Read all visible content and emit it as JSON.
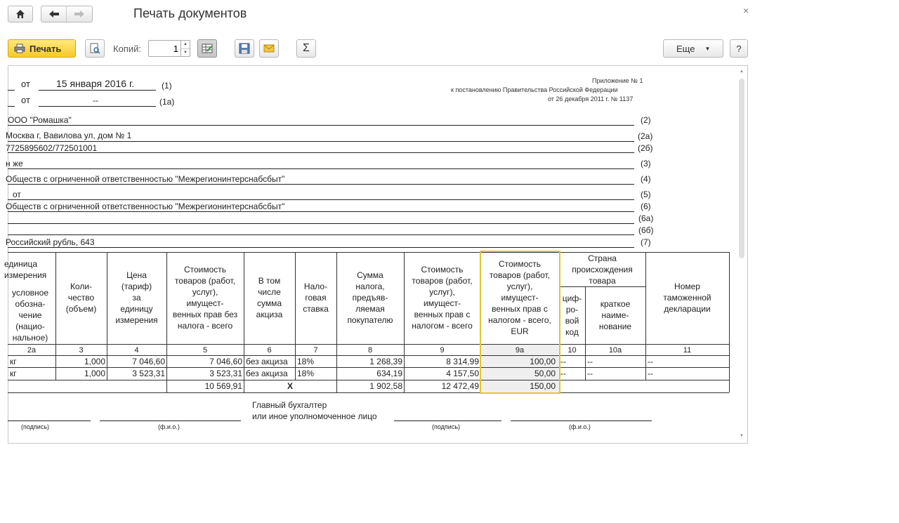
{
  "window": {
    "title": "Печать документов",
    "close_glyph": "×"
  },
  "toolbar": {
    "print_label": "Печать",
    "copies_label": "Копий:",
    "copies_value": "1",
    "more_label": "Еще",
    "help_label": "?",
    "sum_glyph": "Σ"
  },
  "document": {
    "appendix": {
      "line1": "Приложение № 1",
      "line2": "к постановлению Правительства Российской Федерации",
      "line3": "от 26 декабря 2011 г. № 1137"
    },
    "header_rows": [
      {
        "prefix": "от",
        "value": "15 января 2016 г.",
        "code": "(1)"
      },
      {
        "prefix": "от",
        "value": "--",
        "code": "(1а)"
      }
    ],
    "fields": [
      {
        "value": "ООО \"Ромашка\"",
        "code": "(2)"
      },
      {
        "value": "Москва г, Вавилова ул, дом № 1",
        "code": "(2а)"
      },
      {
        "value": "7725895602/772501001",
        "code": "(2б)"
      },
      {
        "value": "н же",
        "code": "(3)"
      },
      {
        "value": "Обществ с огрниченной ответственностью \"Межрегионинтерснабсбыт\"",
        "code": "(4)"
      },
      {
        "value": "от",
        "code": "(5)"
      },
      {
        "value": "Обществ с огрниченной ответственностью \"Межрегионинтерснабсбыт\"",
        "code": "(6)"
      },
      {
        "value": "",
        "code": "(6а)"
      },
      {
        "value": "",
        "code": "(6б)"
      },
      {
        "value": "Российский рубль, 643",
        "code": "(7)"
      }
    ],
    "table": {
      "headers": {
        "unit": "единица\nизмерения",
        "unit_code": "условное\nобозна-\nчение\n(нацио-\nнальное)",
        "qty": "Коли-\nчество\n(объем)",
        "price": "Цена\n(тариф)\nза\nединицу\nизмерения",
        "cost_no_tax": "Стоимость\nтоваров (работ,\nуслуг),\nимущест-\nвенных прав без\nналога - всего",
        "excise": "В том\nчисле\nсумма\nакциза",
        "tax_rate": "Нало-\nговая\nставка",
        "tax_sum": "Сумма\nналога,\nпредъяв-\nляемая\nпокупателю",
        "cost_with_tax": "Стоимость\nтоваров (работ,\nуслуг),\nимущест-\nвенных прав с\nналогом - всего",
        "cost_eur": "Стоимость\nтоваров (работ,\nуслуг),\nимущест-\nвенных прав с\nналогом - всего,\nEUR",
        "country": "Страна\nпроисхождения\nтовара",
        "country_code": "циф-\nро-\nвой\nкод",
        "country_name": "краткое\nнаиме-\nнование",
        "customs": "Номер\nтаможенной\nдекларации"
      },
      "col_numbers": [
        "2а",
        "3",
        "4",
        "5",
        "6",
        "7",
        "8",
        "9",
        "9а",
        "10",
        "10а",
        "11"
      ],
      "rows": [
        {
          "unit": "кг",
          "qty": "1,000",
          "price": "7 046,60",
          "cost": "7 046,60",
          "excise": "без акциза",
          "rate": "18%",
          "tax": "1 268,39",
          "total": "8 314,99",
          "eur": "100,00",
          "ccode": "--",
          "cname": "--",
          "customs": "--"
        },
        {
          "unit": "кг",
          "qty": "1,000",
          "price": "3 523,31",
          "cost": "3 523,31",
          "excise": "без акциза",
          "rate": "18%",
          "tax": "634,19",
          "total": "4 157,50",
          "eur": "50,00",
          "ccode": "--",
          "cname": "--",
          "customs": "--"
        }
      ],
      "totals": {
        "cost": "10 569,91",
        "excise": "X",
        "tax": "1 902,58",
        "total": "12 472,49",
        "eur": "150,00"
      }
    },
    "signatures": {
      "chief_accountant": "Главный бухгалтер\nили иное уполномоченное лицо",
      "sign_hint": "(подпись)",
      "name_hint": "(ф.и.о.)"
    }
  },
  "icons": [
    "home-icon",
    "back-arrow-icon",
    "forward-arrow-icon",
    "printer-icon",
    "preview-icon",
    "table-edit-icon",
    "save-icon",
    "mail-icon",
    "sum-icon",
    "dropdown-arrow-icon"
  ]
}
